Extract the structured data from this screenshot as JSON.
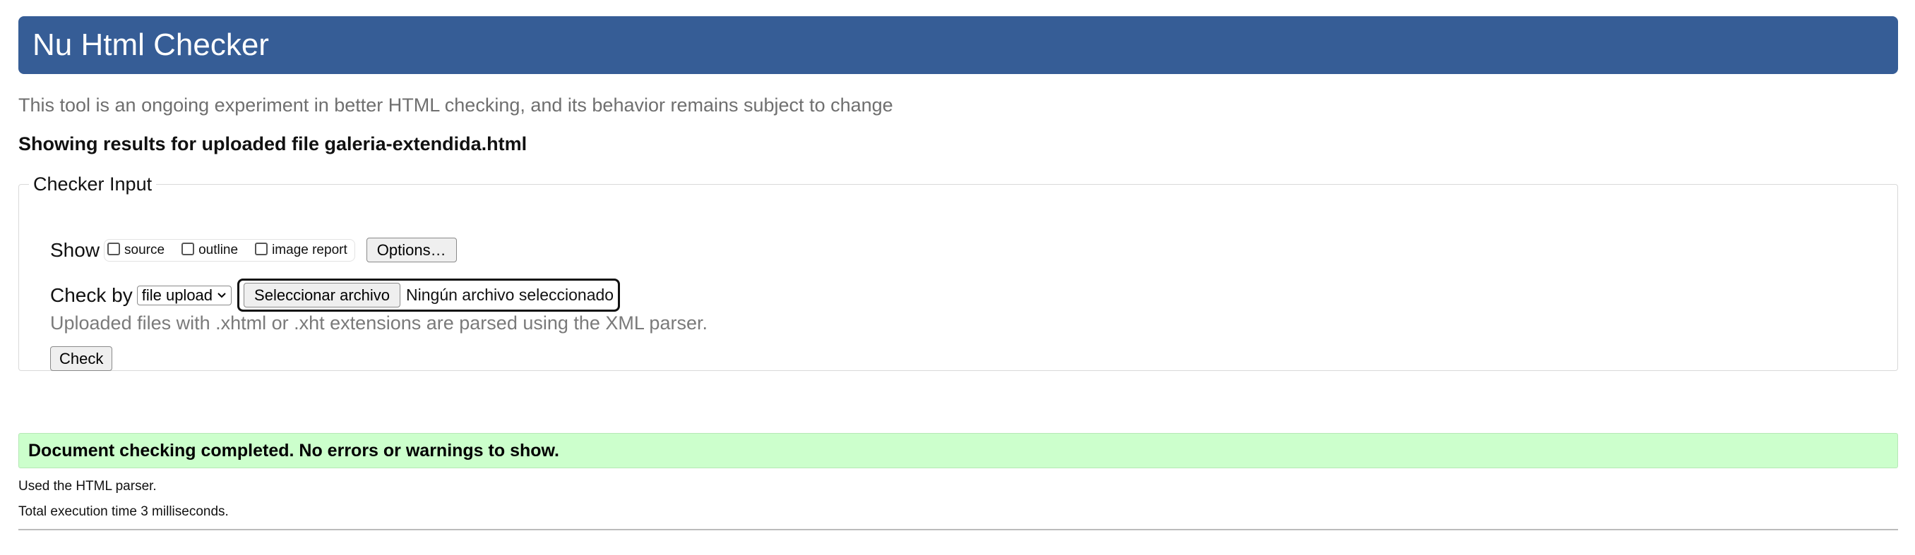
{
  "header": {
    "title": "Nu Html Checker",
    "accent_color": "#365d96"
  },
  "intro": "This tool is an ongoing experiment in better HTML checking, and its behavior remains subject to change",
  "results_heading": "Showing results for uploaded file galeria-extendida.html",
  "checker_input": {
    "legend": "Checker Input",
    "show_label": "Show",
    "options": [
      {
        "label": "source",
        "checked": false
      },
      {
        "label": "outline",
        "checked": false
      },
      {
        "label": "image report",
        "checked": false
      }
    ],
    "options_button": "Options…",
    "check_by_label": "Check by",
    "check_by_value": "file upload",
    "file_button": "Seleccionar archivo",
    "file_status": "Ningún archivo seleccionado",
    "hint": "Uploaded files with .xhtml or .xht extensions are parsed using the XML parser.",
    "check_button": "Check"
  },
  "result": {
    "message": "Document checking completed. No errors or warnings to show.",
    "parser_note": "Used the HTML parser.",
    "execution_time": "Total execution time 3 milliseconds.",
    "success_color": "#ccffcc"
  }
}
